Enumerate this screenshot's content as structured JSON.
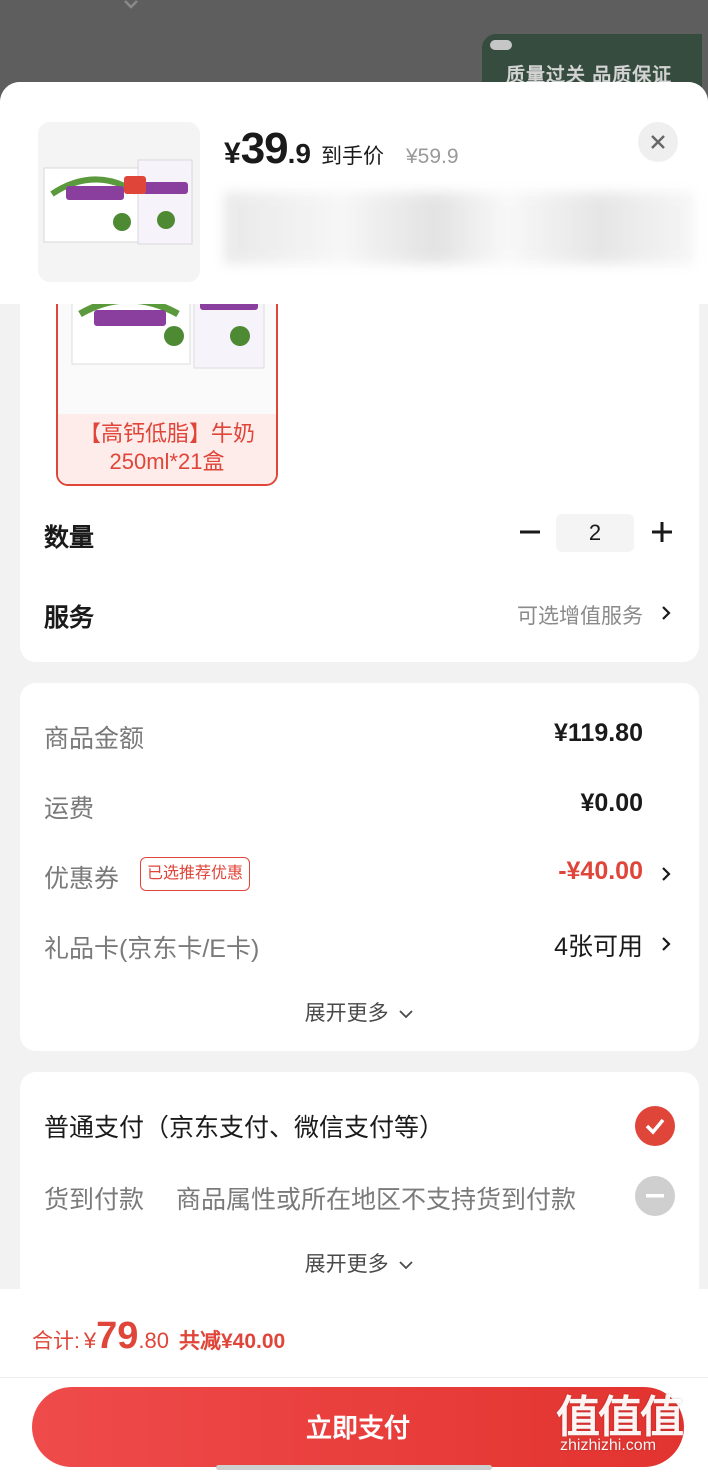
{
  "backdrop": {
    "badge_text": "质量过关 品质保证"
  },
  "header": {
    "price_yen": "¥",
    "price_int": "39",
    "price_dec": ".9",
    "price_label": "到手价",
    "original_price": "¥59.9"
  },
  "spec": {
    "sku_label": "【高钙低脂】牛奶250ml*21盒",
    "quantity_label": "数量",
    "quantity_value": "2",
    "service_label": "服务",
    "service_value": "可选增值服务"
  },
  "amounts": {
    "items": [
      {
        "label": "商品金额",
        "value": "¥119.80"
      },
      {
        "label": "运费",
        "value": "¥0.00"
      },
      {
        "label": "优惠券",
        "value": "-¥40.00",
        "tag": "已选推荐优惠"
      },
      {
        "label": "礼品卡(京东卡/E卡)",
        "value": "4张可用"
      }
    ],
    "expand_more": "展开更多"
  },
  "payment": {
    "standard": "普通支付（京东支付、微信支付等）",
    "cod_label": "货到付款",
    "cod_note": "商品属性或所在地区不支持货到付款",
    "expand_more": "展开更多"
  },
  "footer": {
    "total_label": "合计:",
    "total_yen": "¥",
    "total_int": "79",
    "total_dec": ".80",
    "total_save": "共减¥40.00",
    "pay_button": "立即支付"
  },
  "watermark": {
    "logo": "值值值",
    "url": "zhizhizhi.com"
  },
  "colors": {
    "accent": "#e0453a",
    "text": "#1a1a1a",
    "muted": "#7a7a7a",
    "background": "#f2f2f2"
  },
  "icons": [
    "close-icon",
    "minus-icon",
    "plus-icon",
    "chevron-right-icon",
    "chevron-down-icon",
    "check-icon",
    "disabled-icon"
  ]
}
